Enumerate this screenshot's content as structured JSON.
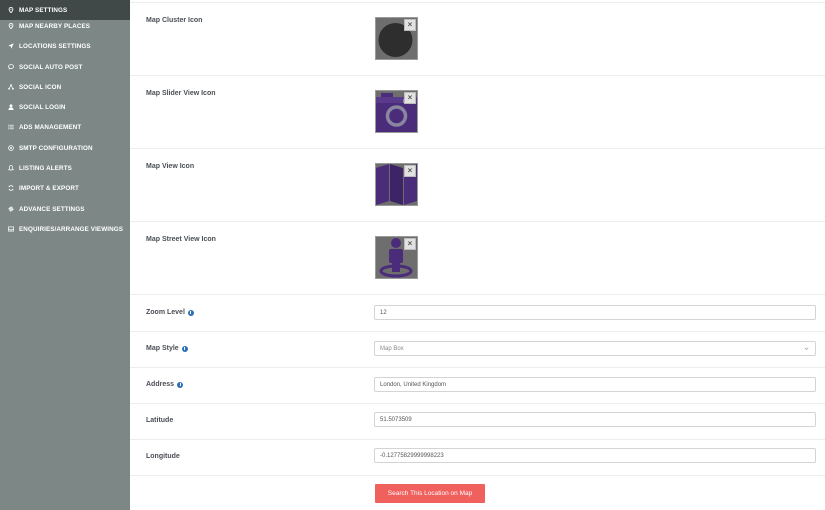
{
  "sidebar": {
    "items": [
      {
        "label": "MAP SETTINGS",
        "icon": "map-pin-icon"
      },
      {
        "label": "MAP NEARBY PLACES",
        "icon": "map-pin-icon"
      },
      {
        "label": "LOCATIONS SETTINGS",
        "icon": "location-arrow-icon"
      },
      {
        "label": "SOCIAL AUTO POST",
        "icon": "chat-bubble-icon"
      },
      {
        "label": "SOCIAL ICON",
        "icon": "share-icon"
      },
      {
        "label": "SOCIAL LOGIN",
        "icon": "user-icon"
      },
      {
        "label": "ADS MANAGEMENT",
        "icon": "list-icon"
      },
      {
        "label": "SMTP CONFIGURATION",
        "icon": "at-sign-icon"
      },
      {
        "label": "LISTING ALERTS",
        "icon": "bell-icon"
      },
      {
        "label": "IMPORT & EXPORT",
        "icon": "sync-icon"
      },
      {
        "label": "ADVANCE SETTINGS",
        "icon": "gear-icon"
      },
      {
        "label": "ENQUIRIES/ARRANGE VIEWINGS",
        "icon": "inbox-icon"
      }
    ],
    "active_index": 0
  },
  "icons": {
    "cluster_label": "Map Cluster Icon",
    "slider_label": "Map Slider View Icon",
    "view_label": "Map View Icon",
    "street_label": "Map Street View Icon",
    "remove_glyph": "×"
  },
  "form": {
    "zoom_label": "Zoom Level",
    "zoom_value": "12",
    "style_label": "Map Style",
    "style_value": "Map Box",
    "address_label": "Address",
    "address_value": "London, United Kingdom",
    "latitude_label": "Latitude",
    "latitude_value": "51.5073509",
    "longitude_label": "Longitude",
    "longitude_value": "-0.12775829999998223",
    "search_button": "Search This Location on Map"
  },
  "colors": {
    "sidebar_bg": "#7c8786",
    "sidebar_active": "#404848",
    "accent_purple": "#4b2c7a",
    "button_red": "#f0605d",
    "help_blue": "#2d6fb5"
  }
}
